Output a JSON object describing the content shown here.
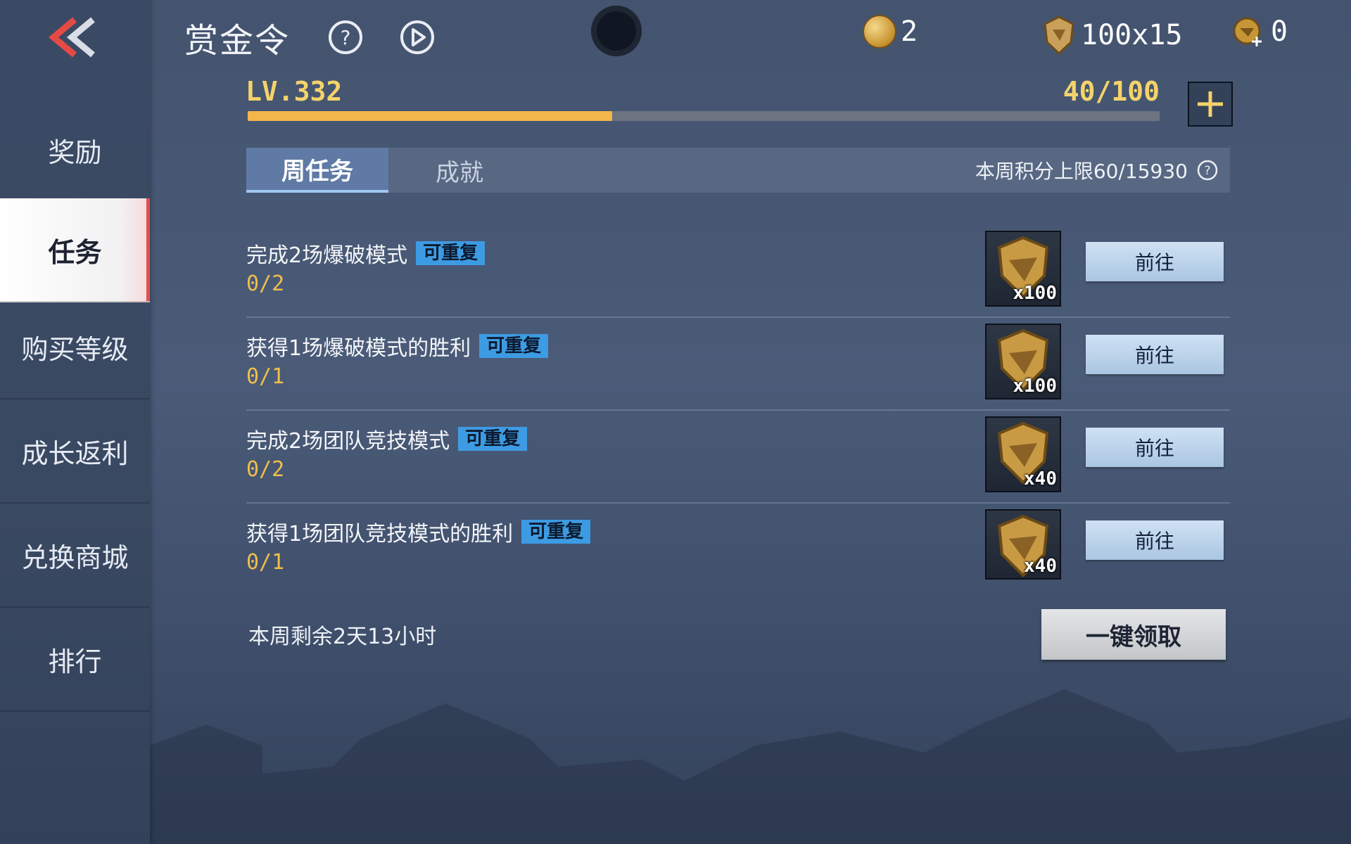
{
  "header": {
    "title": "赏金令",
    "currencies": [
      {
        "icon": "gold-coin-icon",
        "value": "2"
      },
      {
        "icon": "badge-token-icon",
        "value": "100x15"
      },
      {
        "icon": "vip-ticket-icon",
        "value": "0"
      }
    ]
  },
  "sidebar": {
    "items": [
      {
        "label": "奖励"
      },
      {
        "label": "任务"
      },
      {
        "label": "购买等级"
      },
      {
        "label": "成长返利"
      },
      {
        "label": "兑换商城"
      },
      {
        "label": "排行"
      }
    ],
    "active_index": 1
  },
  "level": {
    "label": "LV.332",
    "progress_text": "40/100",
    "progress_fraction": 0.4
  },
  "tabs": {
    "items": [
      {
        "label": "周任务"
      },
      {
        "label": "成就"
      }
    ],
    "active_index": 0,
    "weekly_limit": "本周积分上限60/15930"
  },
  "tasks": [
    {
      "name": "完成2场爆破模式",
      "badge": "可重复",
      "progress": "0/2",
      "reward_qty": "x100",
      "action": "前往"
    },
    {
      "name": "获得1场爆破模式的胜利",
      "badge": "可重复",
      "progress": "0/1",
      "reward_qty": "x100",
      "action": "前往"
    },
    {
      "name": "完成2场团队竞技模式",
      "badge": "可重复",
      "progress": "0/2",
      "reward_qty": "x40",
      "action": "前往"
    },
    {
      "name": "获得1场团队竞技模式的胜利",
      "badge": "可重复",
      "progress": "0/1",
      "reward_qty": "x40",
      "action": "前往"
    }
  ],
  "footer": {
    "remaining": "本周剩余2天13小时",
    "claim_all": "一键领取"
  },
  "colors": {
    "accent_gold": "#f4d36b",
    "progress_fill": "#f3b64a",
    "badge_blue": "#3d9be3",
    "active_marker": "#e05050"
  }
}
